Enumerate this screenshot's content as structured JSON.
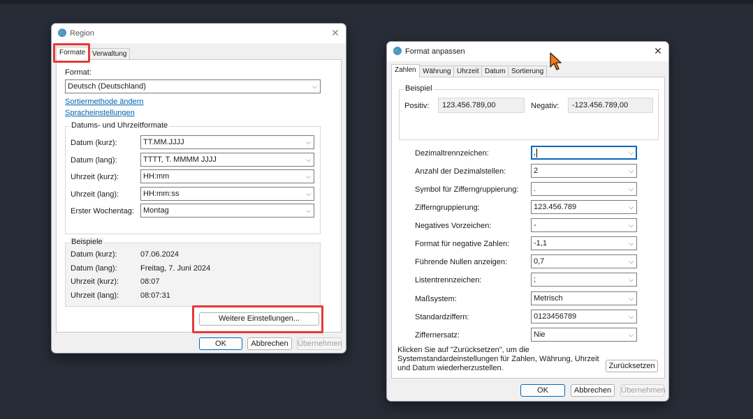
{
  "colors": {
    "desktop": "#272c36",
    "highlight": "#e53935",
    "accent": "#0067c0",
    "link": "#0063b1",
    "cursor": "#f07d19"
  },
  "region": {
    "title": "Region",
    "title_icon": "globe-icon",
    "close_icon": "close-icon",
    "tabs": [
      "Formate",
      "Verwaltung"
    ],
    "format_label": "Format:",
    "format_value": "Deutsch (Deutschland)",
    "sort_link": "Sortiermethode ändern",
    "lang_link": "Spracheinstellungen",
    "dt_group_title": "Datums- und Uhrzeitformate",
    "dt_rows": [
      {
        "label": "Datum (kurz):",
        "value": "TT.MM.JJJJ"
      },
      {
        "label": "Datum (lang):",
        "value": "TTTT, T. MMMM JJJJ"
      },
      {
        "label": "Uhrzeit (kurz):",
        "value": "HH:mm"
      },
      {
        "label": "Uhrzeit (lang):",
        "value": "HH:mm:ss"
      },
      {
        "label": "Erster Wochentag:",
        "value": "Montag"
      }
    ],
    "examples_title": "Beispiele",
    "examples": [
      {
        "label": "Datum (kurz):",
        "value": "07.06.2024"
      },
      {
        "label": "Datum (lang):",
        "value": "Freitag, 7. Juni 2024"
      },
      {
        "label": "Uhrzeit (kurz):",
        "value": "08:07"
      },
      {
        "label": "Uhrzeit (lang):",
        "value": "08:07:31"
      }
    ],
    "more_settings_button": "Weitere Einstellungen...",
    "ok_button": "OK",
    "cancel_button": "Abbrechen",
    "apply_button": "Übernehmen"
  },
  "customize": {
    "title": "Format anpassen",
    "title_icon": "globe-icon",
    "close_icon": "close-icon",
    "tabs": [
      "Zahlen",
      "Währung",
      "Uhrzeit",
      "Datum",
      "Sortierung"
    ],
    "example_title": "Beispiel",
    "positive_label": "Positiv:",
    "positive_value": "123.456.789,00",
    "negative_label": "Negativ:",
    "negative_value": "-123.456.789,00",
    "settings": [
      {
        "label": "Dezimaltrennzeichen:",
        "value": ","
      },
      {
        "label": "Anzahl der Dezimalstellen:",
        "value": "2"
      },
      {
        "label": "Symbol für Zifferngruppierung:",
        "value": "."
      },
      {
        "label": "Zifferngruppierung:",
        "value": "123.456.789"
      },
      {
        "label": "Negatives Vorzeichen:",
        "value": "-"
      },
      {
        "label": "Format für negative Zahlen:",
        "value": "-1,1"
      },
      {
        "label": "Führende Nullen anzeigen:",
        "value": "0,7"
      },
      {
        "label": "Listentrennzeichen:",
        "value": ";"
      },
      {
        "label": "Maßsystem:",
        "value": "Metrisch"
      },
      {
        "label": "Standardziffern:",
        "value": "0123456789"
      },
      {
        "label": "Ziffernersatz:",
        "value": "Nie"
      }
    ],
    "reset_text_lines": [
      "Klicken Sie auf \"Zurücksetzen\", um die",
      "Systemstandardeinstellungen für Zahlen, Währung, Uhrzeit",
      "und Datum wiederherzustellen."
    ],
    "reset_button": "Zurücksetzen",
    "ok_button": "OK",
    "cancel_button": "Abbrechen",
    "apply_button": "Übernehmen"
  }
}
